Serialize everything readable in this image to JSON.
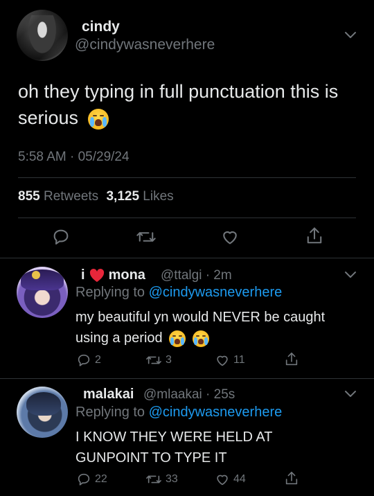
{
  "main_tweet": {
    "display_name": "cindy",
    "handle": "@cindywasneverhere",
    "text": "oh they typing in full punctuation this is serious",
    "timestamp": "5:58 AM · 05/29/24",
    "retweets_count": "855",
    "retweets_label": "Retweets",
    "likes_count": "3,125",
    "likes_label": "Likes"
  },
  "replies": [
    {
      "name_prefix": "i",
      "display_name": "mona",
      "handle_time": "@ttalgi · 2m",
      "replying_label": "Replying to",
      "replying_to": "@cindywasneverhere",
      "text": "my beautiful yn would NEVER be caught using a period",
      "reply_count": "2",
      "retweet_count": "3",
      "like_count": "11"
    },
    {
      "display_name": "malakai",
      "handle_time": "@mlaakai · 25s",
      "replying_label": "Replying to",
      "replying_to": "@cindywasneverhere",
      "text": "I KNOW THEY WERE HELD AT GUNPOINT TO TYPE IT",
      "reply_count": "22",
      "retweet_count": "33",
      "like_count": "44"
    }
  ],
  "icons": {
    "reply": "reply-icon",
    "retweet": "retweet-icon",
    "like": "heart-icon",
    "share": "share-icon",
    "more": "chevron-down-icon",
    "emoji": "loudly-crying-face-emoji",
    "name_emoji": "red-heart-emoji"
  },
  "colors": {
    "background": "#000000",
    "text": "#e7e9ea",
    "secondary": "#71767b",
    "accent": "#1d9bf0",
    "divider": "#2f3336"
  }
}
